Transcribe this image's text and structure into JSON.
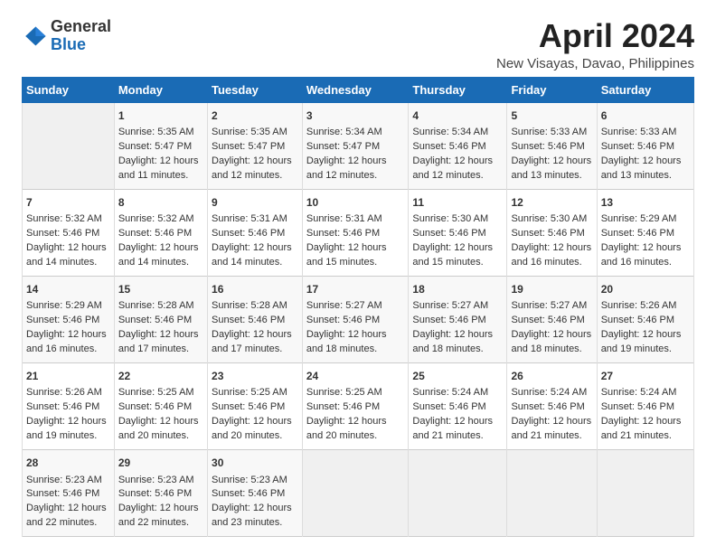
{
  "logo": {
    "general": "General",
    "blue": "Blue"
  },
  "title": "April 2024",
  "subtitle": "New Visayas, Davao, Philippines",
  "days_of_week": [
    "Sunday",
    "Monday",
    "Tuesday",
    "Wednesday",
    "Thursday",
    "Friday",
    "Saturday"
  ],
  "weeks": [
    [
      {
        "day": "",
        "info": ""
      },
      {
        "day": "1",
        "info": "Sunrise: 5:35 AM\nSunset: 5:47 PM\nDaylight: 12 hours and 11 minutes."
      },
      {
        "day": "2",
        "info": "Sunrise: 5:35 AM\nSunset: 5:47 PM\nDaylight: 12 hours and 12 minutes."
      },
      {
        "day": "3",
        "info": "Sunrise: 5:34 AM\nSunset: 5:47 PM\nDaylight: 12 hours and 12 minutes."
      },
      {
        "day": "4",
        "info": "Sunrise: 5:34 AM\nSunset: 5:46 PM\nDaylight: 12 hours and 12 minutes."
      },
      {
        "day": "5",
        "info": "Sunrise: 5:33 AM\nSunset: 5:46 PM\nDaylight: 12 hours and 13 minutes."
      },
      {
        "day": "6",
        "info": "Sunrise: 5:33 AM\nSunset: 5:46 PM\nDaylight: 12 hours and 13 minutes."
      }
    ],
    [
      {
        "day": "7",
        "info": "Sunrise: 5:32 AM\nSunset: 5:46 PM\nDaylight: 12 hours and 14 minutes."
      },
      {
        "day": "8",
        "info": "Sunrise: 5:32 AM\nSunset: 5:46 PM\nDaylight: 12 hours and 14 minutes."
      },
      {
        "day": "9",
        "info": "Sunrise: 5:31 AM\nSunset: 5:46 PM\nDaylight: 12 hours and 14 minutes."
      },
      {
        "day": "10",
        "info": "Sunrise: 5:31 AM\nSunset: 5:46 PM\nDaylight: 12 hours and 15 minutes."
      },
      {
        "day": "11",
        "info": "Sunrise: 5:30 AM\nSunset: 5:46 PM\nDaylight: 12 hours and 15 minutes."
      },
      {
        "day": "12",
        "info": "Sunrise: 5:30 AM\nSunset: 5:46 PM\nDaylight: 12 hours and 16 minutes."
      },
      {
        "day": "13",
        "info": "Sunrise: 5:29 AM\nSunset: 5:46 PM\nDaylight: 12 hours and 16 minutes."
      }
    ],
    [
      {
        "day": "14",
        "info": "Sunrise: 5:29 AM\nSunset: 5:46 PM\nDaylight: 12 hours and 16 minutes."
      },
      {
        "day": "15",
        "info": "Sunrise: 5:28 AM\nSunset: 5:46 PM\nDaylight: 12 hours and 17 minutes."
      },
      {
        "day": "16",
        "info": "Sunrise: 5:28 AM\nSunset: 5:46 PM\nDaylight: 12 hours and 17 minutes."
      },
      {
        "day": "17",
        "info": "Sunrise: 5:27 AM\nSunset: 5:46 PM\nDaylight: 12 hours and 18 minutes."
      },
      {
        "day": "18",
        "info": "Sunrise: 5:27 AM\nSunset: 5:46 PM\nDaylight: 12 hours and 18 minutes."
      },
      {
        "day": "19",
        "info": "Sunrise: 5:27 AM\nSunset: 5:46 PM\nDaylight: 12 hours and 18 minutes."
      },
      {
        "day": "20",
        "info": "Sunrise: 5:26 AM\nSunset: 5:46 PM\nDaylight: 12 hours and 19 minutes."
      }
    ],
    [
      {
        "day": "21",
        "info": "Sunrise: 5:26 AM\nSunset: 5:46 PM\nDaylight: 12 hours and 19 minutes."
      },
      {
        "day": "22",
        "info": "Sunrise: 5:25 AM\nSunset: 5:46 PM\nDaylight: 12 hours and 20 minutes."
      },
      {
        "day": "23",
        "info": "Sunrise: 5:25 AM\nSunset: 5:46 PM\nDaylight: 12 hours and 20 minutes."
      },
      {
        "day": "24",
        "info": "Sunrise: 5:25 AM\nSunset: 5:46 PM\nDaylight: 12 hours and 20 minutes."
      },
      {
        "day": "25",
        "info": "Sunrise: 5:24 AM\nSunset: 5:46 PM\nDaylight: 12 hours and 21 minutes."
      },
      {
        "day": "26",
        "info": "Sunrise: 5:24 AM\nSunset: 5:46 PM\nDaylight: 12 hours and 21 minutes."
      },
      {
        "day": "27",
        "info": "Sunrise: 5:24 AM\nSunset: 5:46 PM\nDaylight: 12 hours and 21 minutes."
      }
    ],
    [
      {
        "day": "28",
        "info": "Sunrise: 5:23 AM\nSunset: 5:46 PM\nDaylight: 12 hours and 22 minutes."
      },
      {
        "day": "29",
        "info": "Sunrise: 5:23 AM\nSunset: 5:46 PM\nDaylight: 12 hours and 22 minutes."
      },
      {
        "day": "30",
        "info": "Sunrise: 5:23 AM\nSunset: 5:46 PM\nDaylight: 12 hours and 23 minutes."
      },
      {
        "day": "",
        "info": ""
      },
      {
        "day": "",
        "info": ""
      },
      {
        "day": "",
        "info": ""
      },
      {
        "day": "",
        "info": ""
      }
    ]
  ]
}
